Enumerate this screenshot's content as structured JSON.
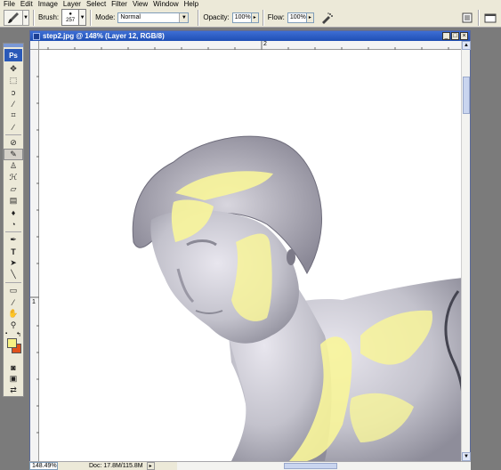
{
  "menu": [
    "File",
    "Edit",
    "Image",
    "Layer",
    "Select",
    "Filter",
    "View",
    "Window",
    "Help"
  ],
  "options": {
    "brush_label": "Brush:",
    "brush_size": "257",
    "mode_label": "Mode:",
    "mode_value": "Normal",
    "opacity_label": "Opacity:",
    "opacity_value": "100%",
    "flow_label": "Flow:",
    "flow_value": "100%"
  },
  "tools_panel": {
    "logo": "Ps",
    "foreground_color": "#f7f183",
    "background_color": "#e0511c"
  },
  "document": {
    "title": "step2.jpg @ 148% (Layer 12, RGB/8)",
    "ruler_h_label": "2",
    "ruler_v_label": "1"
  },
  "status": {
    "zoom": "148.49%",
    "doc_info": "Doc: 17.8M/115.8M"
  }
}
